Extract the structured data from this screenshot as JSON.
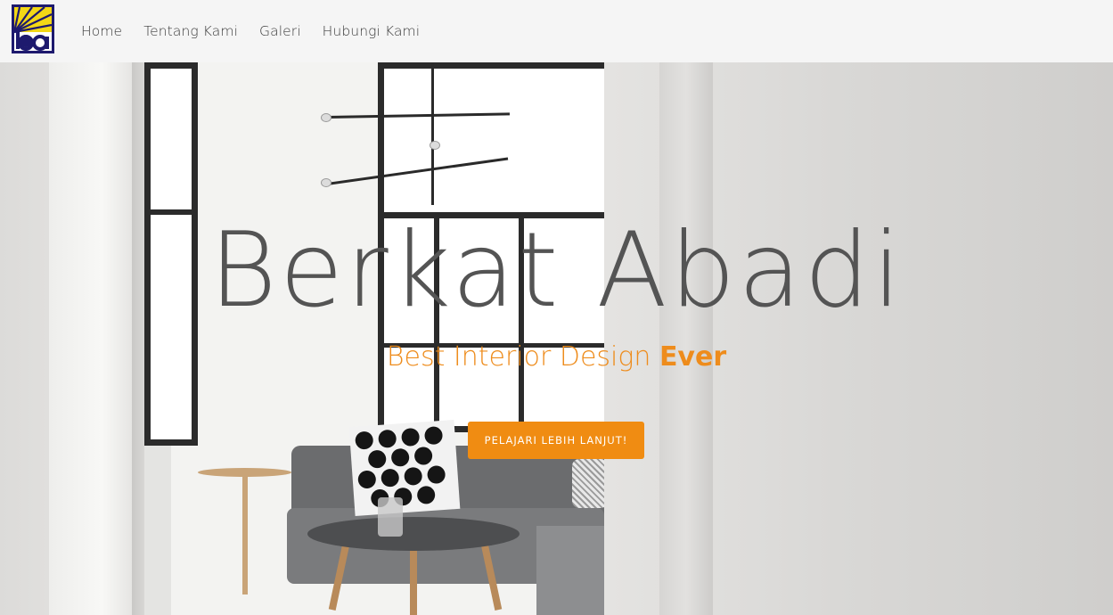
{
  "navbar": {
    "logo_alt": "ba",
    "links": [
      {
        "label": "Home"
      },
      {
        "label": "Tentang Kami"
      },
      {
        "label": "Galeri"
      },
      {
        "label": "Hubungi Kami"
      }
    ]
  },
  "hero": {
    "title": "Berkat Abadi",
    "subtitle_prefix": "Best Interior Design",
    "subtitle_emphasis": "Ever",
    "cta_label": "PELAJARI LEBIH LANJUT!"
  },
  "colors": {
    "accent": "#f08c12",
    "subtitle": "#ee8c1c",
    "title": "#545454",
    "navbar_bg": "#f5f5f5",
    "logo_frame": "#1e1a6e",
    "logo_sun": "#f3d816"
  }
}
